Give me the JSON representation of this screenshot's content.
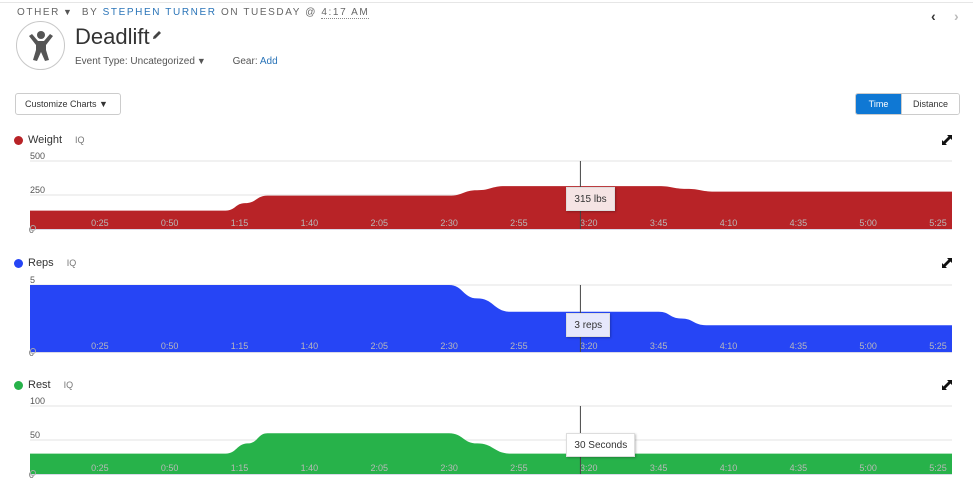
{
  "header": {
    "category": "OTHER",
    "by_label": "BY",
    "author": "STEPHEN TURNER",
    "on_label": "ON TUESDAY @",
    "time": "4:17 AM",
    "title": "Deadlift",
    "event_type_label": "Event Type: Uncategorized",
    "gear_label": "Gear:",
    "gear_add": "Add",
    "prev_icon": "chevron-left-icon",
    "next_icon": "chevron-right-icon",
    "avatar_icon": "person-icon",
    "edit_icon": "pencil-icon"
  },
  "toolbar": {
    "customize_label": "Customize Charts ▼",
    "toggle": [
      {
        "label": "Time",
        "active": true
      },
      {
        "label": "Distance",
        "active": false
      }
    ]
  },
  "chart_data": [
    {
      "type": "area",
      "name": "Weight",
      "iq_label": "IQ",
      "color": "#b82327",
      "tooltip_bg": "#f5e4e4",
      "unit": "lbs",
      "ylim": [
        0,
        500
      ],
      "yticks": [
        "500",
        "250",
        "0"
      ],
      "ytick_values": [
        500,
        250,
        0
      ],
      "xlim_seconds": [
        0,
        330
      ],
      "xticks": [
        "0:25",
        "0:50",
        "1:15",
        "1:40",
        "2:05",
        "2:30",
        "2:55",
        "3:20",
        "3:45",
        "4:10",
        "4:35",
        "5:00",
        "5:25"
      ],
      "x_seconds": [
        0,
        70,
        77,
        85,
        150,
        160,
        170,
        225,
        235,
        245,
        330
      ],
      "values": [
        135,
        135,
        190,
        245,
        245,
        285,
        315,
        315,
        295,
        275,
        275
      ],
      "cursor_seconds": 197,
      "tooltip": "315 lbs"
    },
    {
      "type": "area",
      "name": "Reps",
      "iq_label": "IQ",
      "color": "#2645f5",
      "tooltip_bg": "#e6e8fc",
      "unit": "reps",
      "ylim": [
        0,
        5
      ],
      "yticks": [
        "5",
        "0"
      ],
      "ytick_values": [
        5,
        0
      ],
      "xlim_seconds": [
        0,
        330
      ],
      "xticks": [
        "0:25",
        "0:50",
        "1:15",
        "1:40",
        "2:05",
        "2:30",
        "2:55",
        "3:20",
        "3:45",
        "4:10",
        "4:35",
        "5:00",
        "5:25"
      ],
      "x_seconds": [
        0,
        150,
        160,
        172,
        225,
        233,
        242,
        330
      ],
      "values": [
        5,
        5,
        4,
        3,
        3,
        2.5,
        2,
        2
      ],
      "cursor_seconds": 197,
      "tooltip": "3 reps"
    },
    {
      "type": "area",
      "name": "Rest",
      "iq_label": "IQ",
      "color": "#27b24a",
      "tooltip_bg": "#ffffff",
      "unit": "Seconds",
      "ylim": [
        0,
        100
      ],
      "yticks": [
        "100",
        "50",
        "0"
      ],
      "ytick_values": [
        100,
        50,
        0
      ],
      "xlim_seconds": [
        0,
        330
      ],
      "xticks": [
        "0:25",
        "0:50",
        "1:15",
        "1:40",
        "2:05",
        "2:30",
        "2:55",
        "3:20",
        "3:45",
        "4:10",
        "4:35",
        "5:00",
        "5:25"
      ],
      "x_seconds": [
        0,
        70,
        78,
        85,
        150,
        160,
        172,
        330
      ],
      "values": [
        30,
        30,
        45,
        60,
        60,
        45,
        30,
        30
      ],
      "cursor_seconds": 197,
      "tooltip": "30 Seconds"
    }
  ]
}
